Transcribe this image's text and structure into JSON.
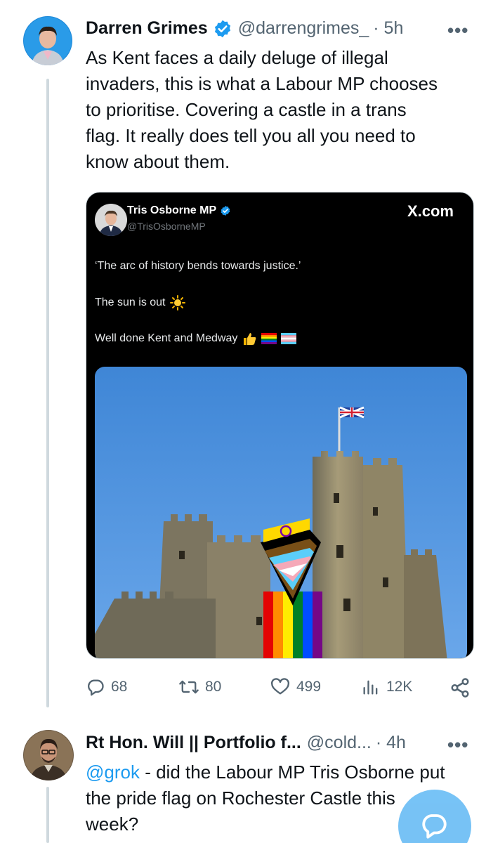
{
  "colors": {
    "accent": "#1d9bf0",
    "muted": "#536471",
    "text": "#0f1419",
    "thread_line": "#cfd9de"
  },
  "post": {
    "author_name": "Darren Grimes",
    "handle": "@darrengrimes_",
    "time": "· 5h",
    "more": "•••",
    "verified_icon": "verified-badge-icon",
    "text_lines": [
      "As Kent faces a daily deluge of illegal",
      "invaders, this is what a Labour MP chooses",
      "to prioritise. Covering a castle in a trans",
      "flag. It really does tell you all you need to",
      "know about them."
    ]
  },
  "embedded": {
    "author_name": "Tris Osborne MP",
    "handle": "@TrisOsborneMP",
    "site": "X.com",
    "line1": "‘The arc of history bends towards justice.’",
    "line2": "The sun is out",
    "line3": "Well done Kent and Medway",
    "photo_icon": "castle-with-pride-flag-photo"
  },
  "actions": {
    "replies": "68",
    "reposts": "80",
    "likes": "499",
    "views": "12K",
    "icons": [
      "reply-icon",
      "repost-icon",
      "like-icon",
      "views-icon",
      "share-icon"
    ]
  },
  "reply": {
    "author_name": "Rt Hon. Will || Portfolio f...",
    "handle": "@cold...",
    "time": "· 4h",
    "more": "•••",
    "mention": "@grok",
    "line1_rest": " - did the Labour MP Tris Osborne put",
    "line2": "the pride flag on Rochester Castle this",
    "line3": "week?"
  }
}
